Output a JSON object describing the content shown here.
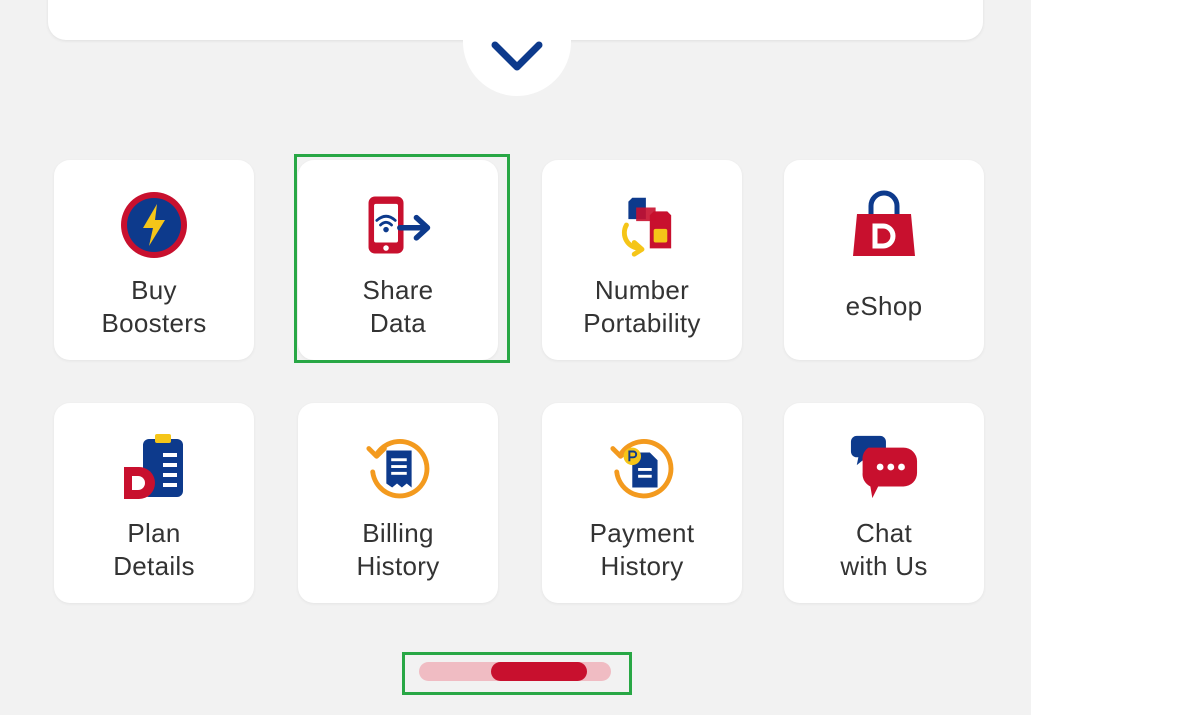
{
  "colors": {
    "brand_red": "#c8102e",
    "brand_blue": "#0d3a8c",
    "accent_yellow": "#f5c518",
    "accent_orange": "#f39a1e",
    "highlight_green": "#28a745",
    "background": "#f2f2f2"
  },
  "expand_button": {
    "icon": "chevron-down-icon"
  },
  "quick_actions": [
    {
      "label": "Buy\nBoosters",
      "icon": "booster-lightning-icon"
    },
    {
      "label": "Share\nData",
      "icon": "share-data-phone-icon"
    },
    {
      "label": "Number\nPortability",
      "icon": "sim-swap-icon"
    },
    {
      "label": "eShop",
      "icon": "shopping-bag-icon"
    },
    {
      "label": "Plan\nDetails",
      "icon": "plan-clipboard-icon"
    },
    {
      "label": "Billing\nHistory",
      "icon": "billing-history-icon"
    },
    {
      "label": "Payment\nHistory",
      "icon": "payment-history-icon"
    },
    {
      "label": "Chat\nwith Us",
      "icon": "chat-bubbles-icon"
    }
  ],
  "pager": {
    "page": 2,
    "total": 2
  }
}
